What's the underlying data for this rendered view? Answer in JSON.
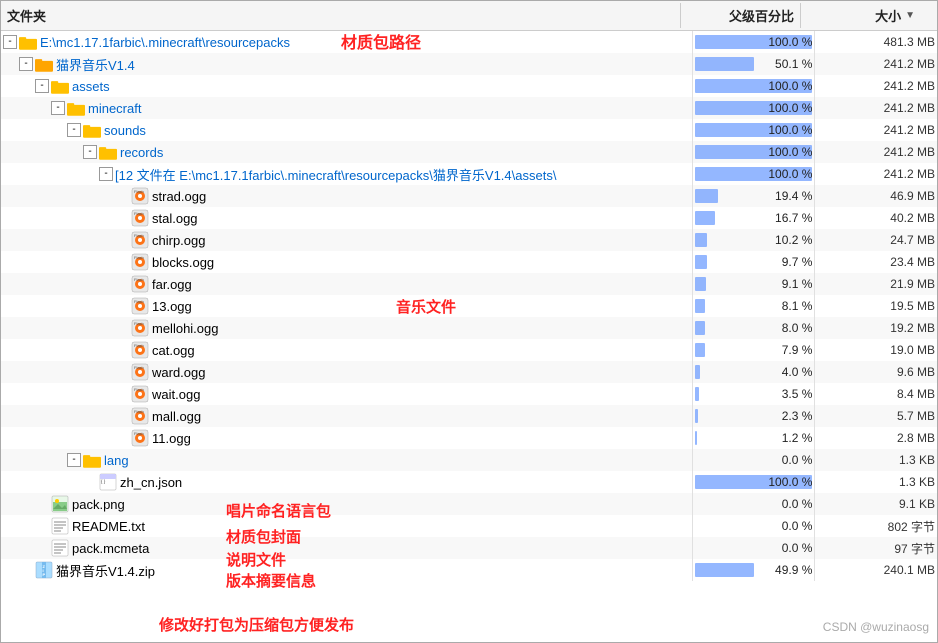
{
  "header": {
    "col_filename": "文件夹",
    "col_parent": "父级百分比",
    "col_size": "大小",
    "sort_arrow": "▼"
  },
  "callouts": {
    "resource_path": "材质包路径",
    "music_files": "音乐文件",
    "lang_pack": "唱片命名语言包",
    "pack_cover": "材质包封面",
    "readme": "说明文件",
    "version": "版本摘要信息",
    "zip_label": "修改好打包为压缩包方便发布"
  },
  "rows": [
    {
      "id": "root",
      "indent": 0,
      "expand": "-",
      "icon": "folder",
      "name": "E:\\mc1.17.1farbic\\.minecraft\\resourcepacks",
      "bar_pct": 100,
      "bar_text": "100.0 %",
      "size": "481.3 MB"
    },
    {
      "id": "cat_pack",
      "indent": 1,
      "expand": "-",
      "icon": "folder_special",
      "name": "猫界音乐V1.4",
      "bar_pct": 50,
      "bar_text": "50.1 %",
      "size": "241.2 MB"
    },
    {
      "id": "assets",
      "indent": 2,
      "expand": "-",
      "icon": "folder",
      "name": "assets",
      "bar_pct": 100,
      "bar_text": "100.0 %",
      "size": "241.2 MB"
    },
    {
      "id": "minecraft",
      "indent": 3,
      "expand": "-",
      "icon": "folder",
      "name": "minecraft",
      "bar_pct": 100,
      "bar_text": "100.0 %",
      "size": "241.2 MB"
    },
    {
      "id": "sounds",
      "indent": 4,
      "expand": "-",
      "icon": "folder",
      "name": "sounds",
      "bar_pct": 100,
      "bar_text": "100.0 %",
      "size": "241.2 MB"
    },
    {
      "id": "records",
      "indent": 5,
      "expand": "-",
      "icon": "folder",
      "name": "records",
      "bar_pct": 100,
      "bar_text": "100.0 %",
      "size": "241.2 MB"
    },
    {
      "id": "files_header",
      "indent": 6,
      "expand": "-",
      "icon": "none",
      "name": "[12 文件在 E:\\mc1.17.1farbic\\.minecraft\\resourcepacks\\猫界音乐V1.4\\assets\\",
      "bar_pct": 100,
      "bar_text": "100.0 %",
      "size": "241.2 MB"
    },
    {
      "id": "strad",
      "indent": 7,
      "expand": "none",
      "icon": "ogg",
      "name": "strad.ogg",
      "bar_pct": 19.4,
      "bar_text": "19.4 %",
      "size": "46.9 MB"
    },
    {
      "id": "stal",
      "indent": 7,
      "expand": "none",
      "icon": "ogg",
      "name": "stal.ogg",
      "bar_pct": 16.7,
      "bar_text": "16.7 %",
      "size": "40.2 MB"
    },
    {
      "id": "chirp",
      "indent": 7,
      "expand": "none",
      "icon": "ogg",
      "name": "chirp.ogg",
      "bar_pct": 10.2,
      "bar_text": "10.2 %",
      "size": "24.7 MB"
    },
    {
      "id": "blocks",
      "indent": 7,
      "expand": "none",
      "icon": "ogg",
      "name": "blocks.ogg",
      "bar_pct": 9.7,
      "bar_text": "9.7 %",
      "size": "23.4 MB"
    },
    {
      "id": "far",
      "indent": 7,
      "expand": "none",
      "icon": "ogg",
      "name": "far.ogg",
      "bar_pct": 9.1,
      "bar_text": "9.1 %",
      "size": "21.9 MB"
    },
    {
      "id": "n13",
      "indent": 7,
      "expand": "none",
      "icon": "ogg",
      "name": "13.ogg",
      "bar_pct": 8.1,
      "bar_text": "8.1 %",
      "size": "19.5 MB"
    },
    {
      "id": "mellohi",
      "indent": 7,
      "expand": "none",
      "icon": "ogg",
      "name": "mellohi.ogg",
      "bar_pct": 8.0,
      "bar_text": "8.0 %",
      "size": "19.2 MB"
    },
    {
      "id": "cat",
      "indent": 7,
      "expand": "none",
      "icon": "ogg",
      "name": "cat.ogg",
      "bar_pct": 7.9,
      "bar_text": "7.9 %",
      "size": "19.0 MB"
    },
    {
      "id": "ward",
      "indent": 7,
      "expand": "none",
      "icon": "ogg",
      "name": "ward.ogg",
      "bar_pct": 4.0,
      "bar_text": "4.0 %",
      "size": "9.6 MB"
    },
    {
      "id": "wait",
      "indent": 7,
      "expand": "none",
      "icon": "ogg",
      "name": "wait.ogg",
      "bar_pct": 3.5,
      "bar_text": "3.5 %",
      "size": "8.4 MB"
    },
    {
      "id": "mall",
      "indent": 7,
      "expand": "none",
      "icon": "ogg",
      "name": "mall.ogg",
      "bar_pct": 2.3,
      "bar_text": "2.3 %",
      "size": "5.7 MB"
    },
    {
      "id": "n11",
      "indent": 7,
      "expand": "none",
      "icon": "ogg",
      "name": "11.ogg",
      "bar_pct": 1.2,
      "bar_text": "1.2 %",
      "size": "2.8 MB"
    },
    {
      "id": "lang",
      "indent": 4,
      "expand": "-",
      "icon": "folder",
      "name": "lang",
      "bar_pct": 0,
      "bar_text": "0.0 %",
      "size": "1.3 KB"
    },
    {
      "id": "zh_cn",
      "indent": 5,
      "expand": "none",
      "icon": "json",
      "name": "zh_cn.json",
      "bar_pct": 100,
      "bar_text": "100.0 %",
      "size": "1.3 KB"
    },
    {
      "id": "pack_png",
      "indent": 2,
      "expand": "none",
      "icon": "image",
      "name": "pack.png",
      "bar_pct": 0,
      "bar_text": "0.0 %",
      "size": "9.1 KB"
    },
    {
      "id": "readme",
      "indent": 2,
      "expand": "none",
      "icon": "text",
      "name": "README.txt",
      "bar_pct": 0,
      "bar_text": "0.0 %",
      "size": "802 字节"
    },
    {
      "id": "pack_meta",
      "indent": 2,
      "expand": "none",
      "icon": "text",
      "name": "pack.mcmeta",
      "bar_pct": 0,
      "bar_text": "0.0 %",
      "size": "97 字节"
    },
    {
      "id": "zip",
      "indent": 1,
      "expand": "none",
      "icon": "zip",
      "name": "猫界音乐V1.4.zip",
      "bar_pct": 50,
      "bar_text": "49.9 %",
      "size": "240.1 MB"
    }
  ]
}
